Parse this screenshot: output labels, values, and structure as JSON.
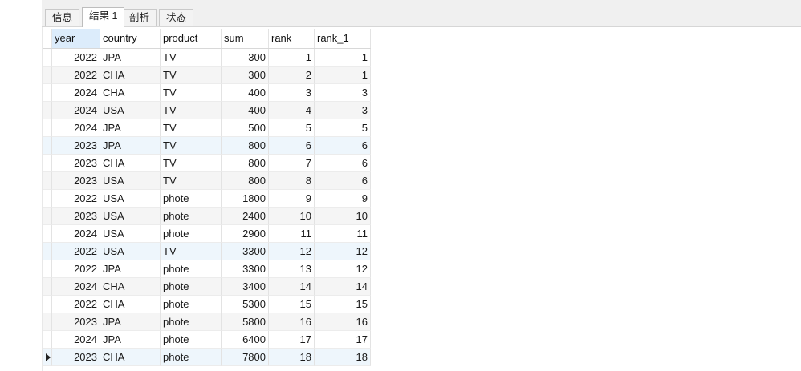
{
  "tabs": [
    {
      "label": "信息"
    },
    {
      "label": "结果 1"
    },
    {
      "label": "剖析"
    },
    {
      "label": "状态"
    }
  ],
  "table": {
    "columns": [
      "year",
      "country",
      "product",
      "sum",
      "rank",
      "rank_1"
    ],
    "rows": [
      [
        "2022",
        "JPA",
        "TV",
        "300",
        "1",
        "1"
      ],
      [
        "2022",
        "CHA",
        "TV",
        "300",
        "2",
        "1"
      ],
      [
        "2024",
        "CHA",
        "TV",
        "400",
        "3",
        "3"
      ],
      [
        "2024",
        "USA",
        "TV",
        "400",
        "4",
        "3"
      ],
      [
        "2024",
        "JPA",
        "TV",
        "500",
        "5",
        "5"
      ],
      [
        "2023",
        "JPA",
        "TV",
        "800",
        "6",
        "6"
      ],
      [
        "2023",
        "CHA",
        "TV",
        "800",
        "7",
        "6"
      ],
      [
        "2023",
        "USA",
        "TV",
        "800",
        "8",
        "6"
      ],
      [
        "2022",
        "USA",
        "phote",
        "1800",
        "9",
        "9"
      ],
      [
        "2023",
        "USA",
        "phote",
        "2400",
        "10",
        "10"
      ],
      [
        "2024",
        "USA",
        "phote",
        "2900",
        "11",
        "11"
      ],
      [
        "2022",
        "USA",
        "TV",
        "3300",
        "12",
        "12"
      ],
      [
        "2022",
        "JPA",
        "phote",
        "3300",
        "13",
        "12"
      ],
      [
        "2024",
        "CHA",
        "phote",
        "3400",
        "14",
        "14"
      ],
      [
        "2022",
        "CHA",
        "phote",
        "5300",
        "15",
        "15"
      ],
      [
        "2023",
        "JPA",
        "phote",
        "5800",
        "16",
        "16"
      ],
      [
        "2024",
        "JPA",
        "phote",
        "6400",
        "17",
        "17"
      ],
      [
        "2023",
        "CHA",
        "phote",
        "7800",
        "18",
        "18"
      ]
    ]
  }
}
